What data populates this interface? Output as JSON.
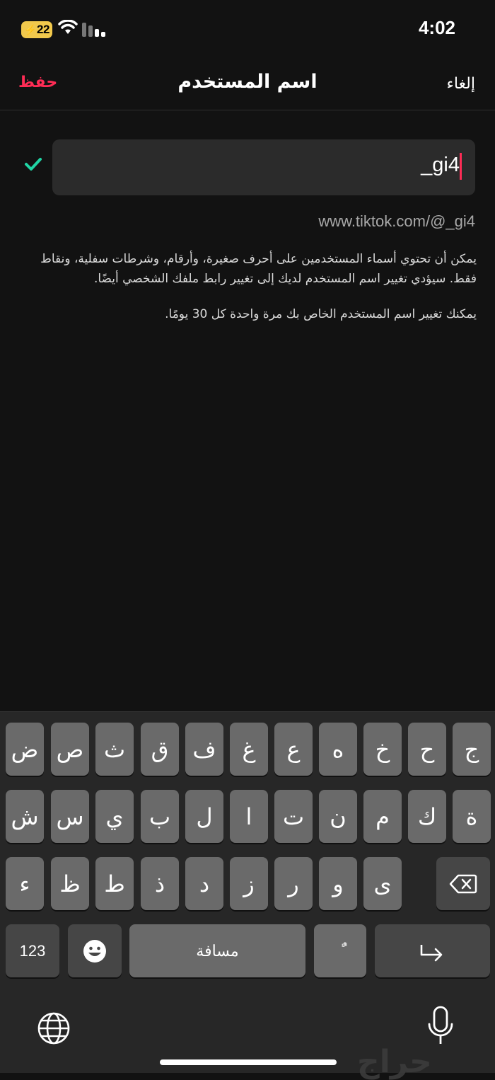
{
  "status_bar": {
    "time": "4:02",
    "battery": "22"
  },
  "nav": {
    "save": "حفظ",
    "title": "اسم المستخدم",
    "cancel": "إلغاء"
  },
  "username": {
    "value": "_gi4",
    "profile_url": "www.tiktok.com/@_gi4"
  },
  "info": {
    "rules": "يمكن أن تحتوي أسماء المستخدمين على أحرف صغيرة، وأرقام، وشرطات سفلية، ونقاط فقط. سيؤدي تغيير اسم المستخدم لديك إلى تغيير رابط ملفك الشخصي أيضًا.",
    "frequency": "يمكنك تغيير اسم المستخدم الخاص بك مرة واحدة كل 30 يومًا."
  },
  "keyboard": {
    "row1": [
      "ض",
      "ص",
      "ث",
      "ق",
      "ف",
      "غ",
      "ع",
      "ه",
      "خ",
      "ح",
      "ج"
    ],
    "row2": [
      "ش",
      "س",
      "ي",
      "ب",
      "ل",
      "ا",
      "ت",
      "ن",
      "م",
      "ك",
      "ة"
    ],
    "row3": [
      "ء",
      "ظ",
      "ط",
      "ذ",
      "د",
      "ز",
      "ر",
      "و",
      "ى"
    ],
    "numbers": "123",
    "space": "مسافة",
    "diacritic": "ًٌ"
  },
  "watermark": "حراج",
  "colors": {
    "accent": "#fe2c55",
    "check": "#20d5a5",
    "battery": "#f2c94c"
  }
}
